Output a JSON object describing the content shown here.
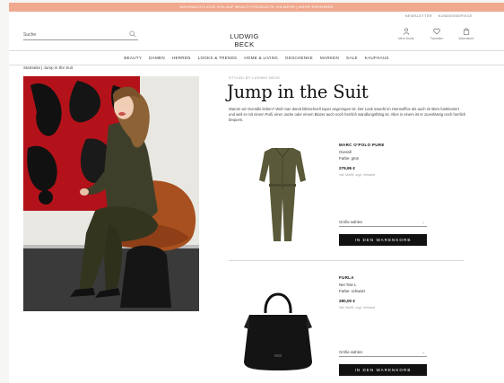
{
  "promo": {
    "text": "WEIHNACHTLICHE 20% AUF BEAUTY-PRODUKTE VIA MEHR  |  MEHR ERFAHREN"
  },
  "util": {
    "newsletter": "NEWSLETTER",
    "service": "KUNDENSERVICE"
  },
  "search": {
    "placeholder": "Suche"
  },
  "logo": "LUDWIG BECK",
  "header_icons": [
    {
      "icon": "user-icon",
      "label": "Mein Konto"
    },
    {
      "icon": "heart-icon",
      "label": "Favoriten"
    },
    {
      "icon": "bag-icon",
      "label": "Warenkorb"
    }
  ],
  "nav": [
    "BEAUTY",
    "DAMEN",
    "HERREN",
    "LOOKS & TRENDS",
    "HOME & LIVING",
    "GESCHENKE",
    "MARKEN",
    "SALE",
    "KAUFHAUS"
  ],
  "breadcrumb": "Startseite  |  Jump in the Suit",
  "editorial": {
    "styled_by": "STYLED BY LUDWIG BECK",
    "title": "Jump in the Suit",
    "intro": "Warum wir Overalls lieben? Weil man damit blitzschnell super angezogen ist. Der Look sowohl im Homeoffice als auch im Büro funktioniert und weil er mit einem Pulli, einer Jacke oder einem Blazer auch noch herrlich wandlungsfähig ist. Alles in einem ist er zuverlässig noch herrlich bequem."
  },
  "products": [
    {
      "brand": "MARC O'POLO PURE",
      "type": "Overall",
      "color": "Farbe: grün",
      "price": "279,95 €",
      "vat": "inkl. MwSt. zzgl. Versand",
      "size_label": "Größe wählen",
      "cart_label": "IN DEN WARENKORB"
    },
    {
      "brand": "FURLA",
      "type": "Net Tote L",
      "color": "Farbe: schwarz",
      "price": "280,00 €",
      "vat": "inkl. MwSt. zzgl. Versand",
      "size_label": "Größe wählen",
      "cart_label": "IN DEN WARENKORB"
    }
  ],
  "colors": {
    "promo": "#f0a98e",
    "jumpsuit": "#5a5a3a",
    "button": "#111111"
  }
}
